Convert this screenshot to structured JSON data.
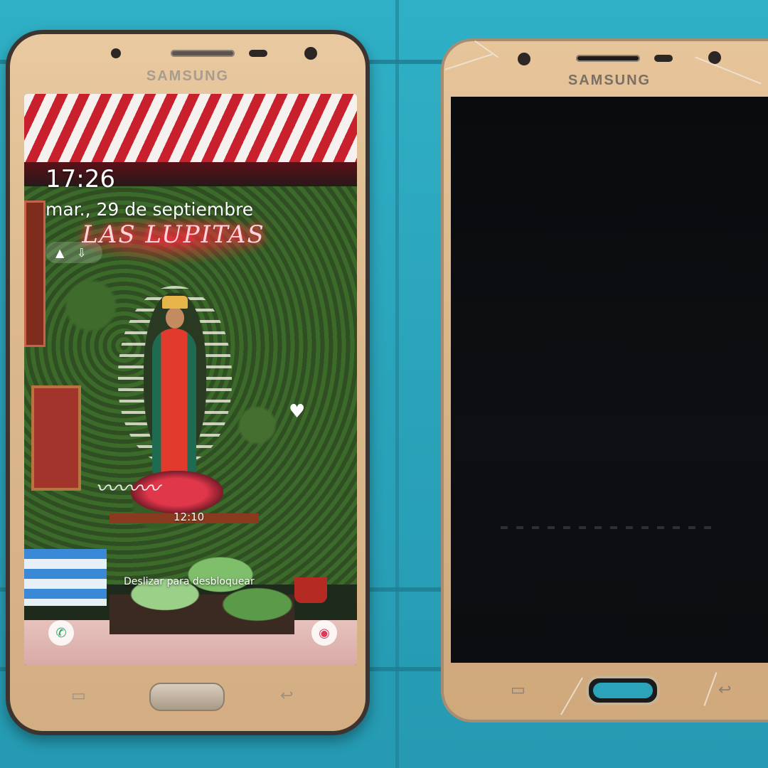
{
  "photo": {
    "background_color": "#2fa5bd",
    "left_phone": {
      "brand": "SAMSUNG",
      "frame_color": "#dcb98d",
      "lock_screen": {
        "time": "17:26",
        "date": "mar., 29 de septiembre",
        "wallpaper_neon_sign": "LAS LUPITAS",
        "wallpaper_small_time": "12:10",
        "unlock_hint": "Deslizar para desbloquear",
        "shortcut_left": "phone-icon",
        "shortcut_right": "camera-icon"
      }
    },
    "right_phone": {
      "brand": "SAMSUNG",
      "frame_color": "#d8b487",
      "screen_state": "off",
      "screen_color": "#0a0b0d"
    }
  }
}
